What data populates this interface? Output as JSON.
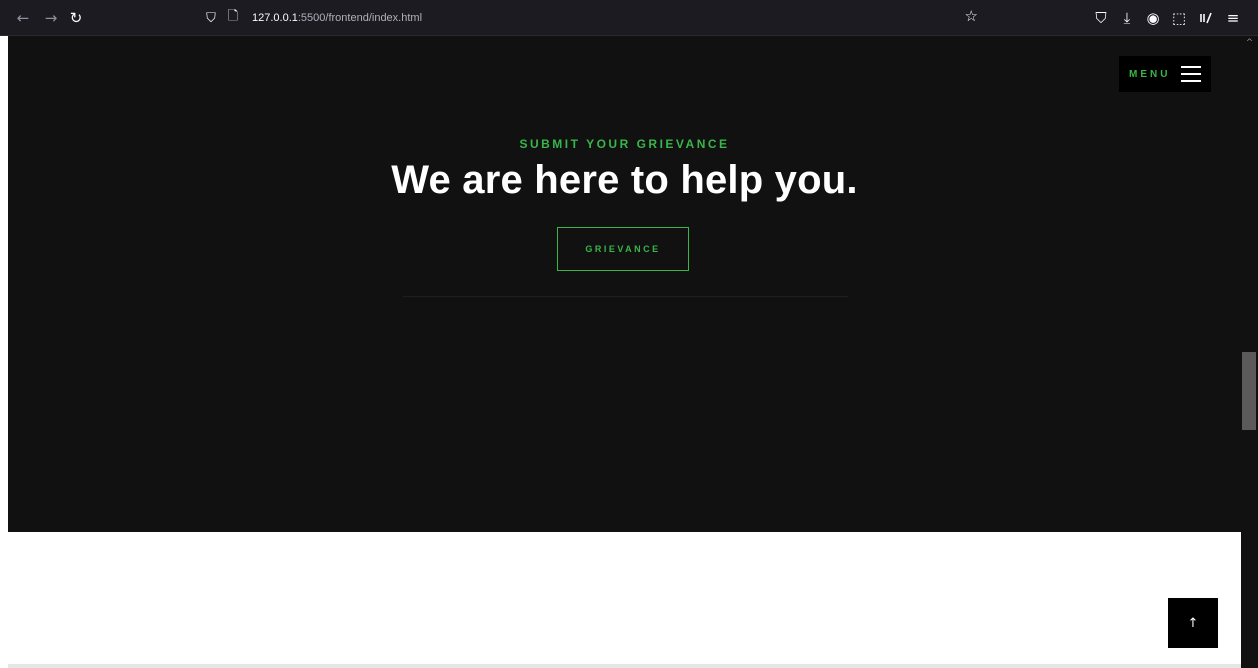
{
  "browser": {
    "url_host": "127.0.0.1",
    "url_rest": ":5500/frontend/index.html",
    "icons": {
      "back": "←",
      "forward": "→",
      "reload": "↻",
      "shield": "⛉",
      "page": "🗋",
      "bookmark": "☆",
      "pocket": "⛉",
      "download": "⤓",
      "account": "◉",
      "extensions": "⬚",
      "app_menu": "≡"
    }
  },
  "header": {
    "menu_label": "MENU"
  },
  "hero": {
    "kicker": "SUBMIT YOUR GRIEVANCE",
    "headline": "We are here to help you.",
    "cta_label": "GRIEVANCE"
  },
  "back_to_top": "↑",
  "colors": {
    "accent": "#39b54a",
    "hero_bg": "#111111",
    "chrome_bg": "#1c1b22"
  }
}
